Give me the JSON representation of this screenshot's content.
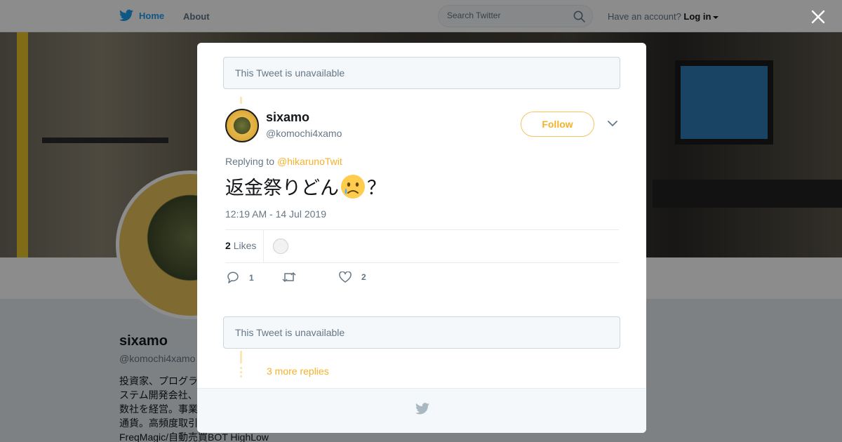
{
  "nav": {
    "home_label": "Home",
    "about_label": "About",
    "search_placeholder": "Search Twitter",
    "account_prompt": "Have an account?",
    "login_label": "Log in"
  },
  "profile": {
    "name": "sixamo",
    "handle": "@komochi4xamo",
    "bio_partial": "投資家、プログラ\nステム開発会社、\n数社を経営。事業\n通貨。高頻度取引",
    "bio_last_line": "FreqMagic/自動売買BOT HighLow"
  },
  "modal": {
    "unavailable_top": "This Tweet is unavailable",
    "unavailable_bottom": "This Tweet is unavailable",
    "tweet": {
      "author_name": "sixamo",
      "author_handle": "@komochi4xamo",
      "follow_label": "Follow",
      "replying_prefix": "Replying to",
      "replying_to": "@hikarunoTwit",
      "text_before": "返金祭りどん",
      "text_after": "？",
      "emoji": "crying-face",
      "timestamp": "12:19 AM - 14 Jul 2019",
      "likes_count": "2",
      "likes_label": "Likes",
      "reply_count": "1",
      "retweet_count": "",
      "like_count": "2"
    },
    "more_replies_label": "3 more replies"
  },
  "colors": {
    "twitter_blue": "#1da1f2",
    "accent_gold": "#f5b129",
    "muted_text": "#657786"
  }
}
